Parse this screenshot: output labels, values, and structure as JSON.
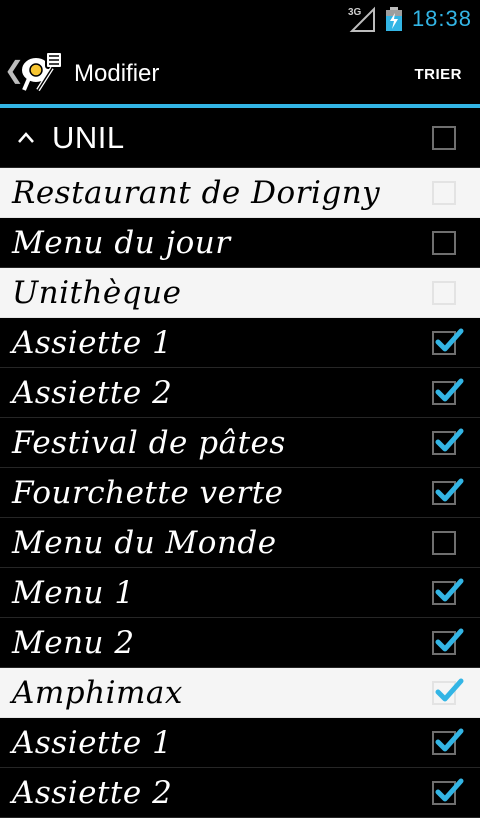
{
  "status": {
    "network": "3G",
    "time": "18:38"
  },
  "actionbar": {
    "back": "❮",
    "title": "Modifier",
    "sort_label": "TRIER"
  },
  "list": [
    {
      "type": "header",
      "label": "UNIL",
      "checked": false
    },
    {
      "type": "section",
      "label": "Restaurant de Dorigny",
      "checked": false
    },
    {
      "type": "item",
      "label": "Menu du jour",
      "checked": false
    },
    {
      "type": "section",
      "label": "Unithèque",
      "checked": false
    },
    {
      "type": "item",
      "label": "Assiette 1",
      "checked": true
    },
    {
      "type": "item",
      "label": "Assiette 2",
      "checked": true
    },
    {
      "type": "item",
      "label": "Festival de pâtes",
      "checked": true
    },
    {
      "type": "item",
      "label": "Fourchette verte",
      "checked": true
    },
    {
      "type": "item",
      "label": "Menu du Monde",
      "checked": false
    },
    {
      "type": "item",
      "label": "Menu 1",
      "checked": true
    },
    {
      "type": "item",
      "label": "Menu 2",
      "checked": true
    },
    {
      "type": "section",
      "label": "Amphimax",
      "checked": true
    },
    {
      "type": "item",
      "label": "Assiette 1",
      "checked": true
    },
    {
      "type": "item",
      "label": "Assiette 2",
      "checked": true
    }
  ],
  "colors": {
    "accent": "#33b5e5",
    "section_bg": "#f5f5f5"
  },
  "icons": {
    "back": "chevron-left-icon",
    "app": "fried-egg-spatula-icon",
    "caret": "chevron-up-icon",
    "check": "checkmark-icon"
  }
}
